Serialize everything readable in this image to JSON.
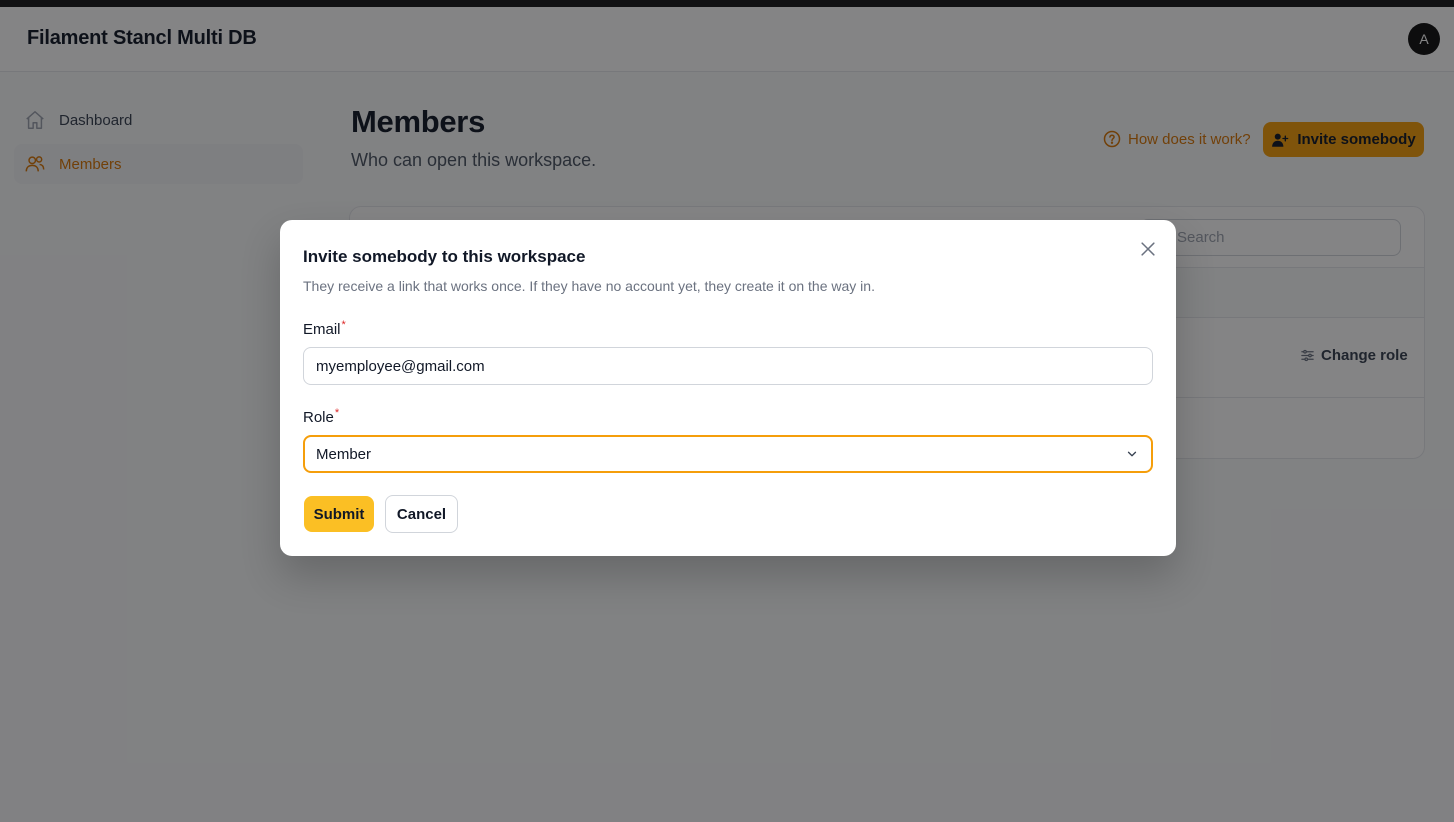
{
  "app": {
    "title": "Filament Stancl Multi DB",
    "avatar_initial": "A"
  },
  "sidebar": {
    "items": [
      {
        "label": "Dashboard",
        "icon": "home-icon",
        "active": false
      },
      {
        "label": "Members",
        "icon": "users-icon",
        "active": true
      }
    ]
  },
  "page": {
    "title": "Members",
    "subtitle": "Who can open this workspace."
  },
  "header_actions": {
    "help_label": "How does it work?",
    "invite_label": "Invite somebody"
  },
  "table": {
    "search_placeholder": "Search",
    "row_action_label": "Change role"
  },
  "modal": {
    "title": "Invite somebody to this workspace",
    "description": "They receive a link that works once. If they have no account yet, they create it on the way in.",
    "email_label": "Email",
    "email_value": "myemployee@gmail.com",
    "role_label": "Role",
    "role_value": "Member",
    "required_mark": "*",
    "submit_label": "Submit",
    "cancel_label": "Cancel"
  },
  "colors": {
    "accent": "#f59e0b",
    "accent_text": "#d97706",
    "required": "#dc2626"
  }
}
